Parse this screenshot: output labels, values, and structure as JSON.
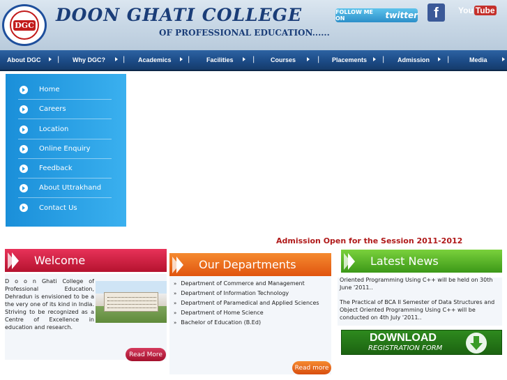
{
  "header": {
    "logo_text": "DGC",
    "title": "DOON GHATI COLLEGE",
    "subtitle": "OF PROFESSIONAL EDUCATION......",
    "social": {
      "twitter_prefix": "FOLLOW ME ON",
      "twitter_brand": "twitter",
      "facebook_letter": "f",
      "youtube_you": "You",
      "youtube_tube": "Tube"
    }
  },
  "nav": {
    "items": [
      "About DGC",
      "Why DGC?",
      "Academics",
      "Facilities",
      "Courses",
      "Placements",
      "Admission",
      "Media"
    ]
  },
  "sidemenu": {
    "items": [
      "Home",
      "Careers",
      "Location",
      "Online Enquiry",
      "Feedback",
      "About Uttrakhand",
      "Contact Us"
    ]
  },
  "admission_notice": "Admission Open for the Session 2011-2012",
  "welcome": {
    "title": "Welcome",
    "text": "D o o n Ghati College of Professional Education, Dehradun is envisioned to be a the very one of its kind in India. Striving to be recognized as a Centre of Excellence in education and research.",
    "read_more": "Read More"
  },
  "departments": {
    "title": "Our Departments",
    "items": [
      "Department of Commerce and Management",
      "Department of Information Technology",
      "Department of Paramedical and Applied Sciences",
      "Department of Home Science",
      "Bachelor of Education (B.Ed)"
    ],
    "bullet": "»",
    "read_more": "Read more"
  },
  "news": {
    "title": "Latest  News",
    "items": [
      "Oriented Programming Using C++ will be held on 30th June '2011..",
      "The Practical of BCA II Semester of Data Structures and Object Oriented Programming Using C++ will be conducted on 4th July '2011.."
    ]
  },
  "download": {
    "title": "DOWNLOAD",
    "subtitle": "REGISTRATION FORM"
  },
  "colors": {
    "header_blue": "#1a3d78",
    "nav_blue": "#1c4b86",
    "side_menu": "#2a9fe6",
    "welcome_red": "#c8203f",
    "depts_orange": "#ee6a1d",
    "news_green": "#5cb52a",
    "admission_red": "#b01a1a"
  }
}
